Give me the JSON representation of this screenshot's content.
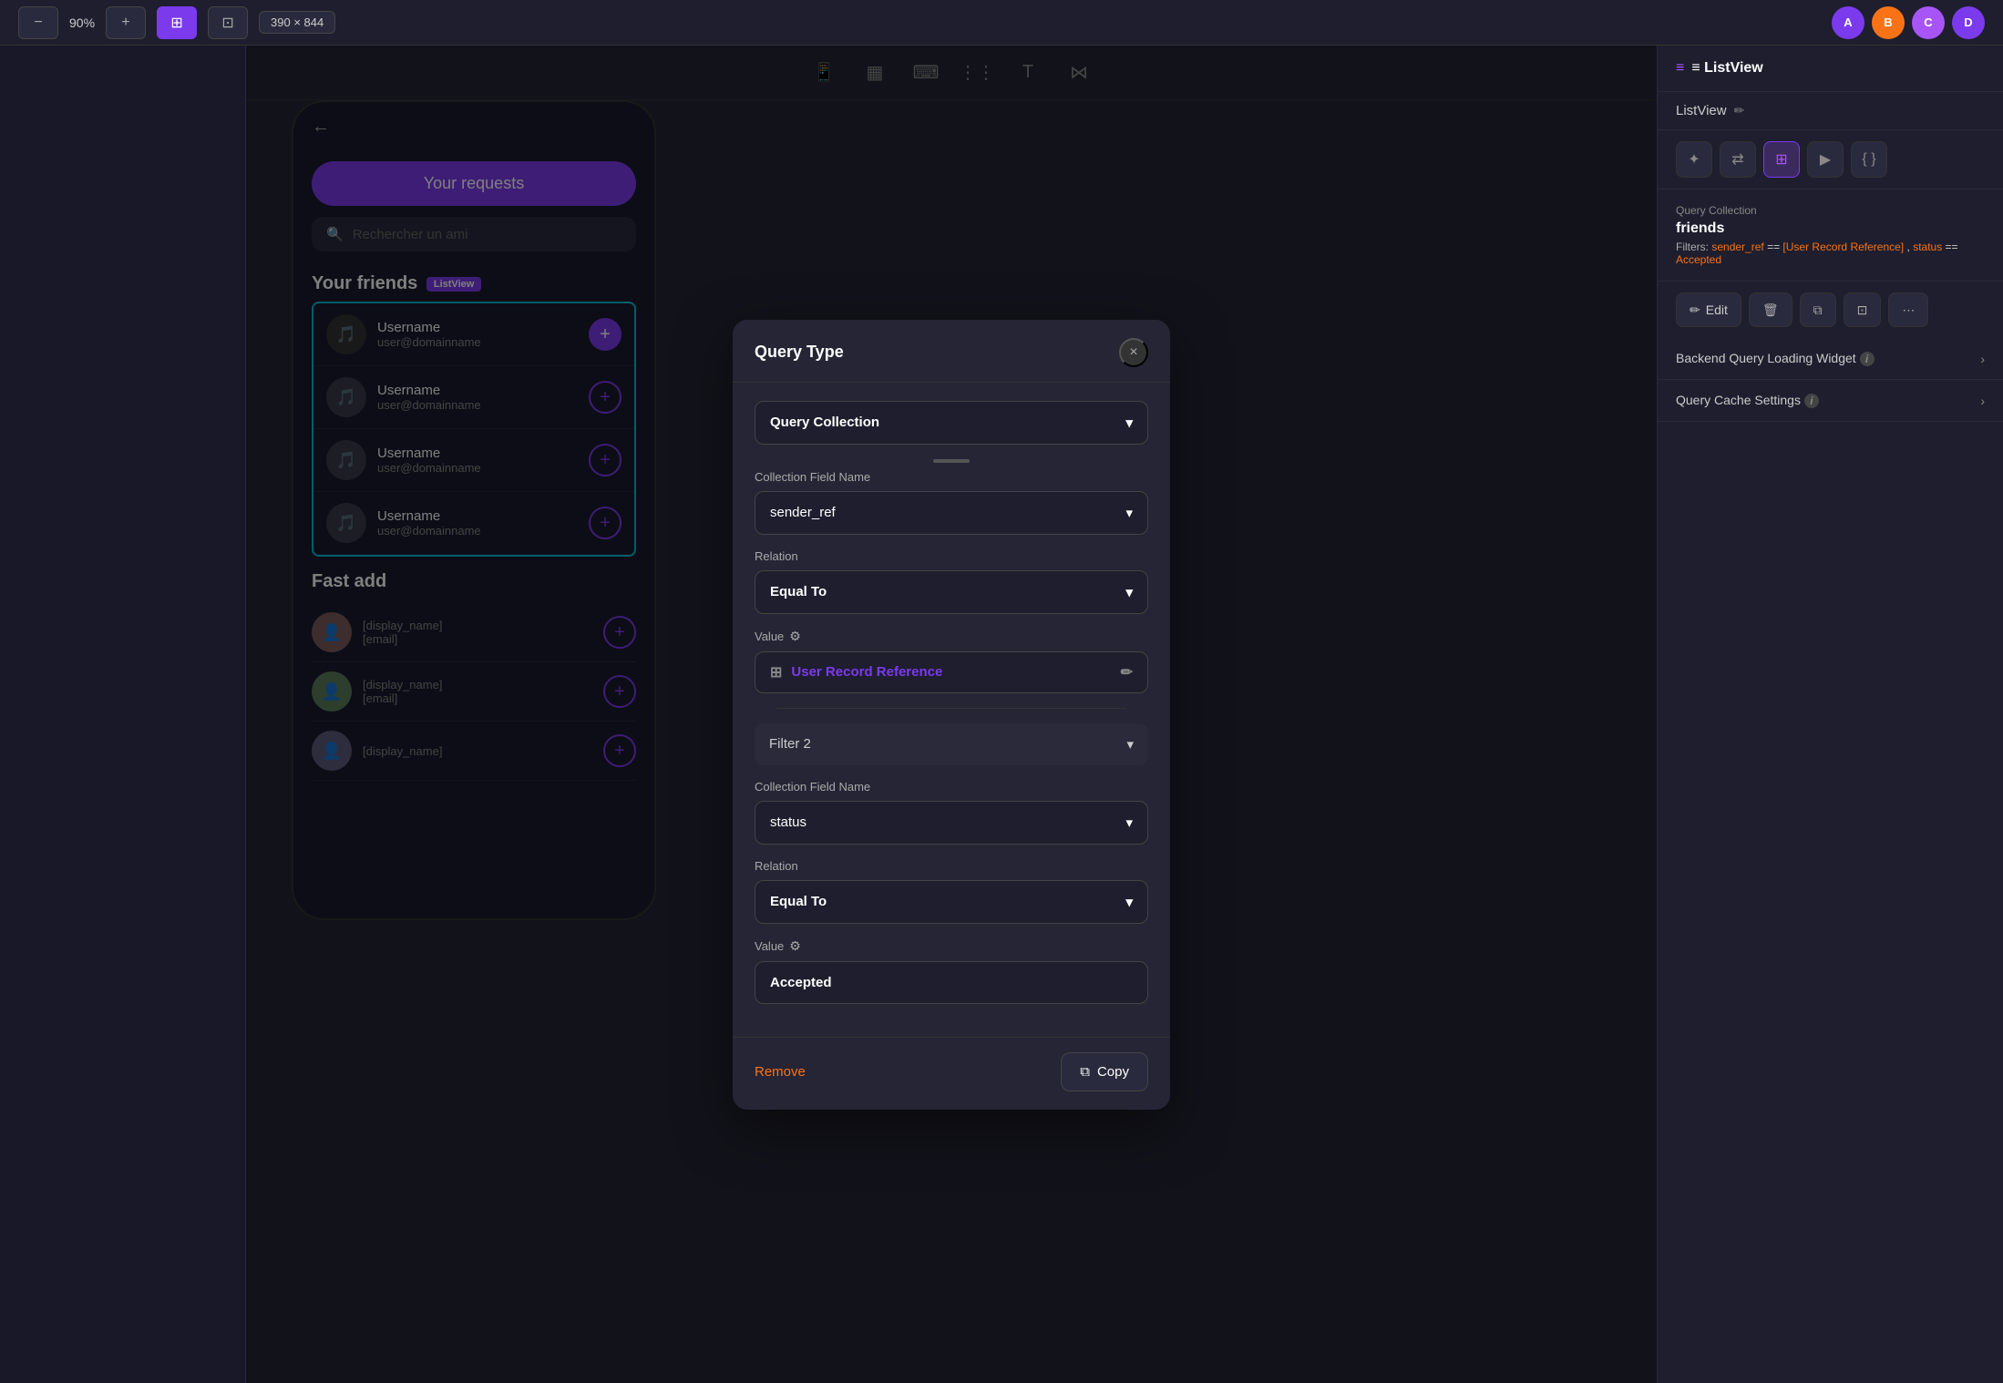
{
  "toolbar": {
    "zoom_level": "90%",
    "dimension": "390 × 844",
    "minus_label": "−",
    "plus_label": "+",
    "tools": [
      "⊞",
      "⊡"
    ],
    "canvas_tools": [
      "📱",
      "▦",
      "⌨",
      "⋮⋮",
      "T",
      "⋈"
    ]
  },
  "right_panel": {
    "component_label": "≡ ListView",
    "component_name": "ListView",
    "query_collection_label": "Query Collection",
    "query_collection_value": "friends",
    "filters_sender_key": "sender_ref",
    "filters_sender_op": " == ",
    "filters_sender_val": "[User Record Reference]",
    "filters_sep": ", ",
    "filters_status_key": "status",
    "filters_status_op": " == ",
    "filters_status_val": "Accepted",
    "edit_btn": "Edit",
    "backend_query_label": "Backend Query Loading Widget",
    "query_cache_label": "Query Cache Settings"
  },
  "phone": {
    "your_requests_btn": "Your requests",
    "search_placeholder": "Rechercher un ami",
    "your_friends_label": "Your friends",
    "listview_badge": "ListView",
    "fast_add_label": "Fast add",
    "friends": [
      {
        "name": "Username",
        "email": "user@domainname"
      },
      {
        "name": "Username",
        "email": "user@domainname"
      },
      {
        "name": "Username",
        "email": "user@domainname"
      },
      {
        "name": "Username",
        "email": "user@domainname"
      }
    ],
    "fast_add_users": [
      {
        "name": "[display_name]",
        "email": "[email]"
      },
      {
        "name": "[display_name]",
        "email": "[email]"
      },
      {
        "name": "[display_name]",
        "email": ""
      }
    ]
  },
  "modal": {
    "title": "Query Type",
    "close_label": "×",
    "query_type_value": "Query Collection",
    "scroll_indicator": true,
    "filter1": {
      "collection_field_label": "Collection Field Name",
      "collection_field_value": "sender_ref",
      "relation_label": "Relation",
      "relation_value": "Equal To",
      "value_label": "Value",
      "value_icon": "⊞",
      "value_text": "User Record Reference"
    },
    "filter2": {
      "header": "Filter 2",
      "collection_field_label": "Collection Field Name",
      "collection_field_value": "status",
      "relation_label": "Relation",
      "relation_value": "Equal To",
      "value_label": "Value",
      "value_text": "Accepted"
    },
    "remove_btn": "Remove",
    "copy_btn": "Copy",
    "copy_icon": "⧉"
  }
}
